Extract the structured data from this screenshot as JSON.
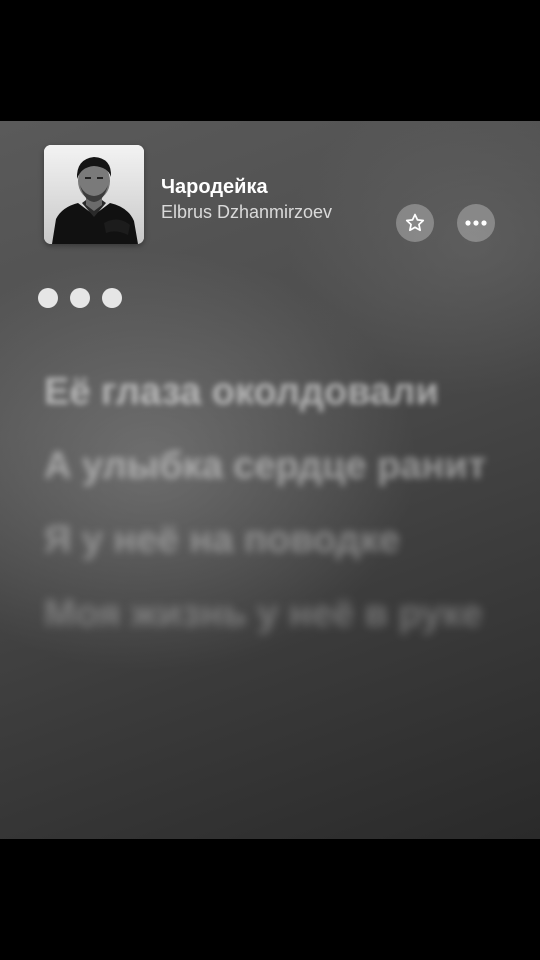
{
  "now_playing": {
    "title": "Чародейка",
    "artist": "Elbrus Dzhanmirzoev",
    "artwork_icon": "album-artwork-portrait"
  },
  "controls": {
    "favorite_icon": "star-icon",
    "more_icon": "ellipsis-icon"
  },
  "loading_indicator": {
    "icon": "three-dots-icon",
    "dot_count": 3
  },
  "lyrics": [
    "Её глаза околдовали",
    "А улыбка сердце ранит",
    "Я у неё на поводке",
    "Моя жизнь у неё в руке"
  ],
  "colors": {
    "background_top": "#5a5a5a",
    "background_bottom": "#2a2a2a",
    "text_primary": "#ffffff",
    "button_fill": "rgba(255,255,255,0.28)"
  }
}
